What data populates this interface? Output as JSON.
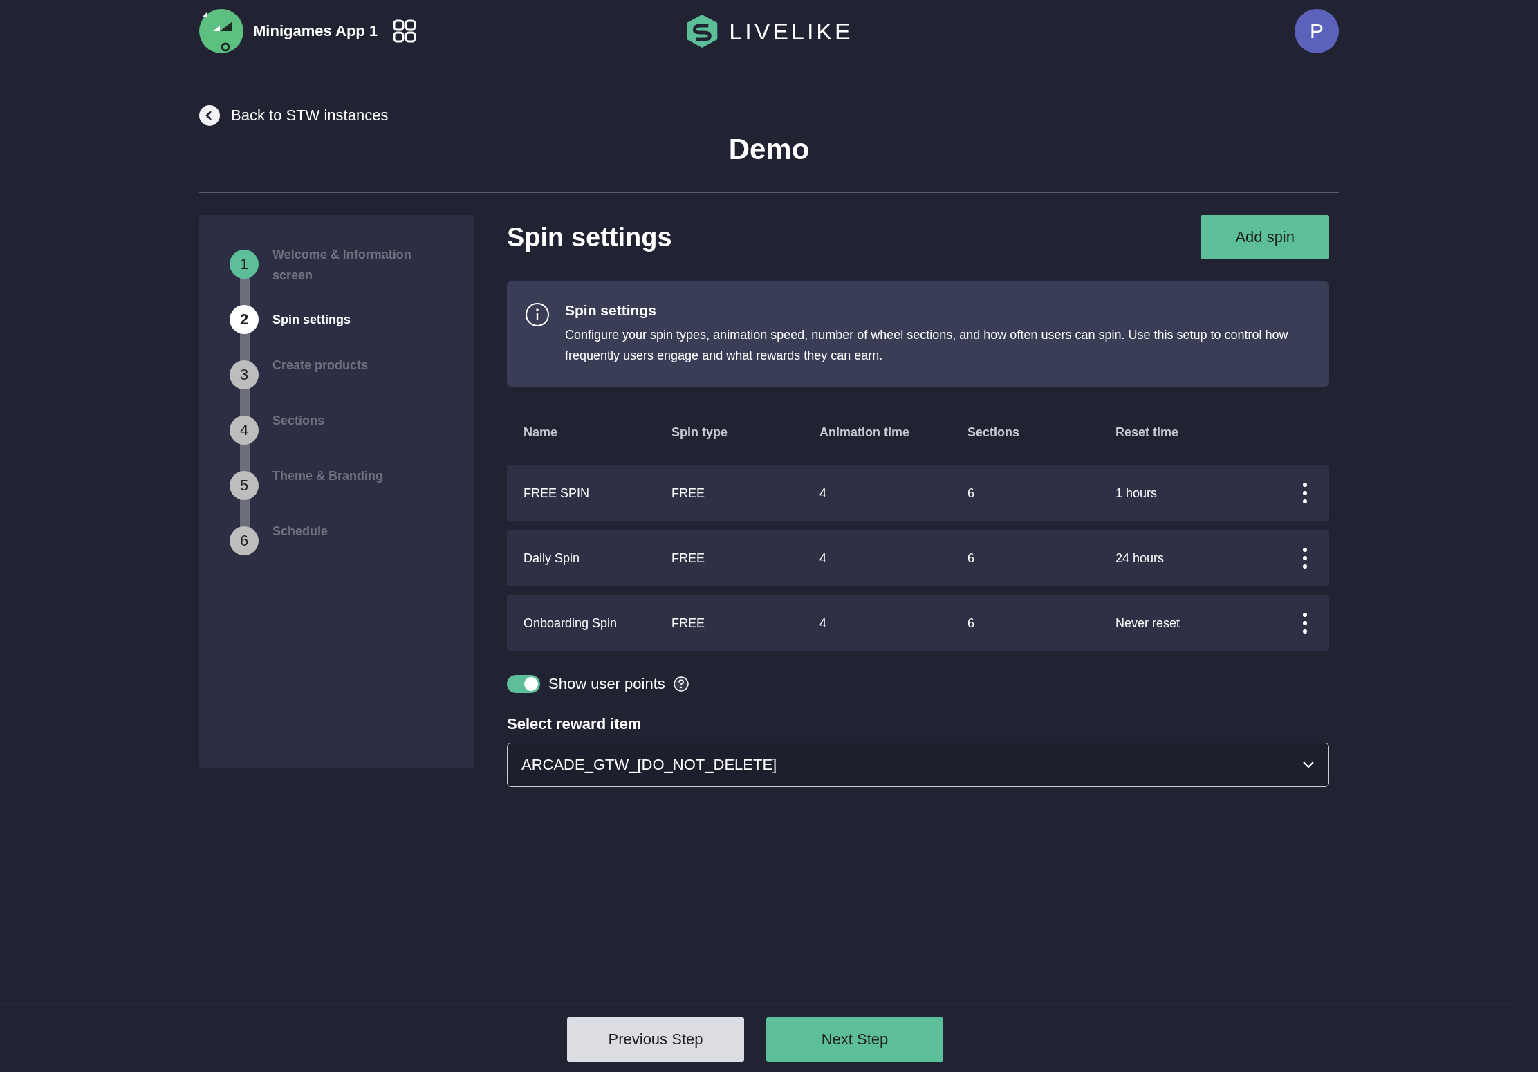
{
  "header": {
    "app_name": "Minigames App 1",
    "brand": "LIVELIKE",
    "avatar_initial": "P"
  },
  "back_link": "Back to STW instances",
  "page_title": "Demo",
  "steps": [
    {
      "number": "1",
      "label": "Welcome & Information screen",
      "completed": true,
      "selected": false
    },
    {
      "number": "2",
      "label": "Spin settings",
      "completed": false,
      "selected": true
    },
    {
      "number": "3",
      "label": "Create products",
      "completed": false,
      "selected": false
    },
    {
      "number": "4",
      "label": "Sections",
      "completed": false,
      "selected": false
    },
    {
      "number": "5",
      "label": "Theme & Branding",
      "completed": false,
      "selected": false
    },
    {
      "number": "6",
      "label": "Schedule",
      "completed": false,
      "selected": false
    }
  ],
  "section_title": "Spin settings",
  "add_button": "Add spin",
  "info": {
    "title": "Spin settings",
    "text": "Configure your spin types, animation speed, number of wheel sections, and how often users can spin. Use this setup to control how frequently users engage and what rewards they can earn."
  },
  "table": {
    "columns": [
      "Name",
      "Spin type",
      "Animation time",
      "Sections",
      "Reset time"
    ],
    "rows": [
      [
        "FREE SPIN",
        "FREE",
        "4",
        "6",
        "1 hours"
      ],
      [
        "Daily Spin",
        "FREE",
        "4",
        "6",
        "24 hours"
      ],
      [
        "Onboarding Spin",
        "FREE",
        "4",
        "6",
        "Never reset"
      ]
    ]
  },
  "show_points": {
    "label": "Show user points",
    "on": true
  },
  "reward": {
    "label": "Select reward item",
    "value": "ARCADE_GTW_[DO_NOT_DELETE]"
  },
  "footer": {
    "previous": "Previous Step",
    "next": "Next Step"
  }
}
